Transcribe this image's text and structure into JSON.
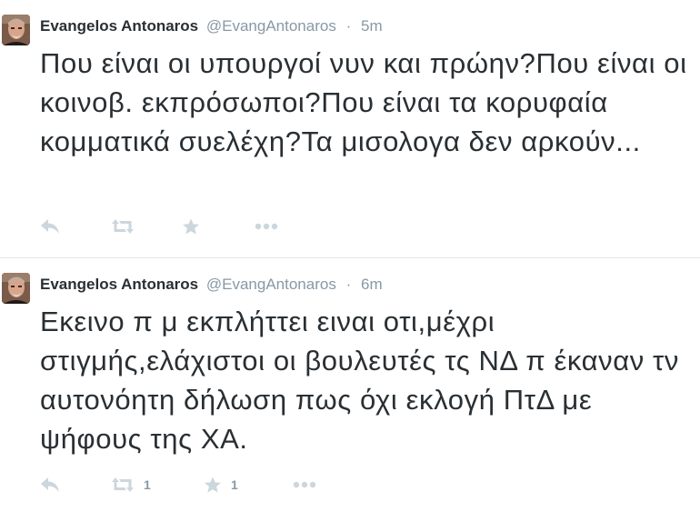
{
  "tweets": [
    {
      "author": {
        "name": "Evangelos Antonaros",
        "handle": "@EvangAntonaros",
        "avatar_icon": "profile-photo"
      },
      "separator": "·",
      "time": "5m",
      "text": "Που είναι οι υπουργοί νυν και πρώην?Που είναι οι κοινοβ. εκπρόσωποι?Που είναι τα κορυφαία κομματικά συελέχη?Τα μισολογα δεν αρκούν...",
      "actions": {
        "reply_icon": "reply-icon",
        "retweet_icon": "retweet-icon",
        "retweet_count": "",
        "favorite_icon": "star-icon",
        "favorite_count": "",
        "more_icon": "more-icon"
      }
    },
    {
      "author": {
        "name": "Evangelos Antonaros",
        "handle": "@EvangAntonaros",
        "avatar_icon": "profile-photo"
      },
      "separator": "·",
      "time": "6m",
      "text": "Εκεινο π μ εκπλήττει ειναι οτι,μέχρι στιγμής,ελάχιστοι οι βουλευτές τς ΝΔ π έκαναν τν αυτονόητη δήλωση πως όχι εκλογή ΠτΔ με ψήφους της ΧΑ.",
      "actions": {
        "reply_icon": "reply-icon",
        "retweet_icon": "retweet-icon",
        "retweet_count": "1",
        "favorite_icon": "star-icon",
        "favorite_count": "1",
        "more_icon": "more-icon"
      }
    }
  ],
  "colors": {
    "name": "#292f33",
    "meta": "#8899a6",
    "text": "#292f33",
    "action_icon": "#ccd6dd",
    "divider": "#e1e8ed"
  }
}
